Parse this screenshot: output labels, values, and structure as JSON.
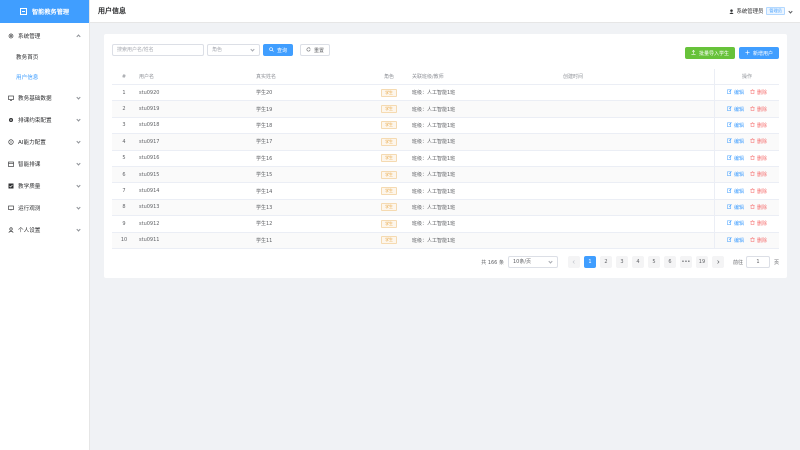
{
  "app": {
    "brand": "智能教务管理"
  },
  "header": {
    "title": "用户信息",
    "user_name": "系统管理员",
    "role_badge": "管理员"
  },
  "sidebar": {
    "items": [
      {
        "label": "系统管理",
        "icon": "gear-icon",
        "expanded": true,
        "children": [
          {
            "label": "教务首页",
            "active": false
          },
          {
            "label": "用户信息",
            "active": true
          }
        ]
      },
      {
        "label": "教务基础数据",
        "icon": "monitor-icon"
      },
      {
        "label": "排课约束配置",
        "icon": "gear-icon"
      },
      {
        "label": "AI能力配置",
        "icon": "cpu-icon"
      },
      {
        "label": "智能排课",
        "icon": "calendar-icon"
      },
      {
        "label": "教学质量",
        "icon": "checklist-icon"
      },
      {
        "label": "运行观测",
        "icon": "monitor-icon"
      },
      {
        "label": "个人设置",
        "icon": "user-icon"
      }
    ]
  },
  "filters": {
    "search_placeholder": "搜索用户名/姓名",
    "role_placeholder": "角色",
    "search_button": "查询",
    "reset_button": "重置"
  },
  "actions": {
    "batch_import": "批量导入学生",
    "add_user": "新增用户"
  },
  "table": {
    "headers": [
      "#",
      "用户名",
      "真实姓名",
      "角色",
      "关联班级/教师",
      "创建时间",
      "操作"
    ],
    "rows": [
      {
        "idx": "1",
        "username": "stu0920",
        "realname": "学生20",
        "role": "学生",
        "relation": "班级：人工智能1班",
        "created": ""
      },
      {
        "idx": "2",
        "username": "stu0919",
        "realname": "学生19",
        "role": "学生",
        "relation": "班级：人工智能1班",
        "created": ""
      },
      {
        "idx": "3",
        "username": "stu0918",
        "realname": "学生18",
        "role": "学生",
        "relation": "班级：人工智能1班",
        "created": ""
      },
      {
        "idx": "4",
        "username": "stu0917",
        "realname": "学生17",
        "role": "学生",
        "relation": "班级：人工智能1班",
        "created": ""
      },
      {
        "idx": "5",
        "username": "stu0916",
        "realname": "学生16",
        "role": "学生",
        "relation": "班级：人工智能1班",
        "created": ""
      },
      {
        "idx": "6",
        "username": "stu0915",
        "realname": "学生15",
        "role": "学生",
        "relation": "班级：人工智能1班",
        "created": ""
      },
      {
        "idx": "7",
        "username": "stu0914",
        "realname": "学生14",
        "role": "学生",
        "relation": "班级：人工智能1班",
        "created": ""
      },
      {
        "idx": "8",
        "username": "stu0913",
        "realname": "学生13",
        "role": "学生",
        "relation": "班级：人工智能1班",
        "created": ""
      },
      {
        "idx": "9",
        "username": "stu0912",
        "realname": "学生12",
        "role": "学生",
        "relation": "班级：人工智能1班",
        "created": ""
      },
      {
        "idx": "10",
        "username": "stu0911",
        "realname": "学生11",
        "role": "学生",
        "relation": "班级：人工智能1班",
        "created": ""
      }
    ],
    "edit_label": "编辑",
    "delete_label": "删除"
  },
  "pagination": {
    "total": "共 166 条",
    "page_size": "10条/页",
    "pages": [
      "1",
      "2",
      "3",
      "4",
      "5",
      "6",
      "•••",
      "19"
    ],
    "current": "1",
    "goto_label": "前往",
    "goto_value": "1",
    "unit": "页"
  },
  "colors": {
    "primary": "#409eff",
    "success": "#67c23a",
    "danger": "#f56c6c",
    "warning": "#e6a23c"
  }
}
